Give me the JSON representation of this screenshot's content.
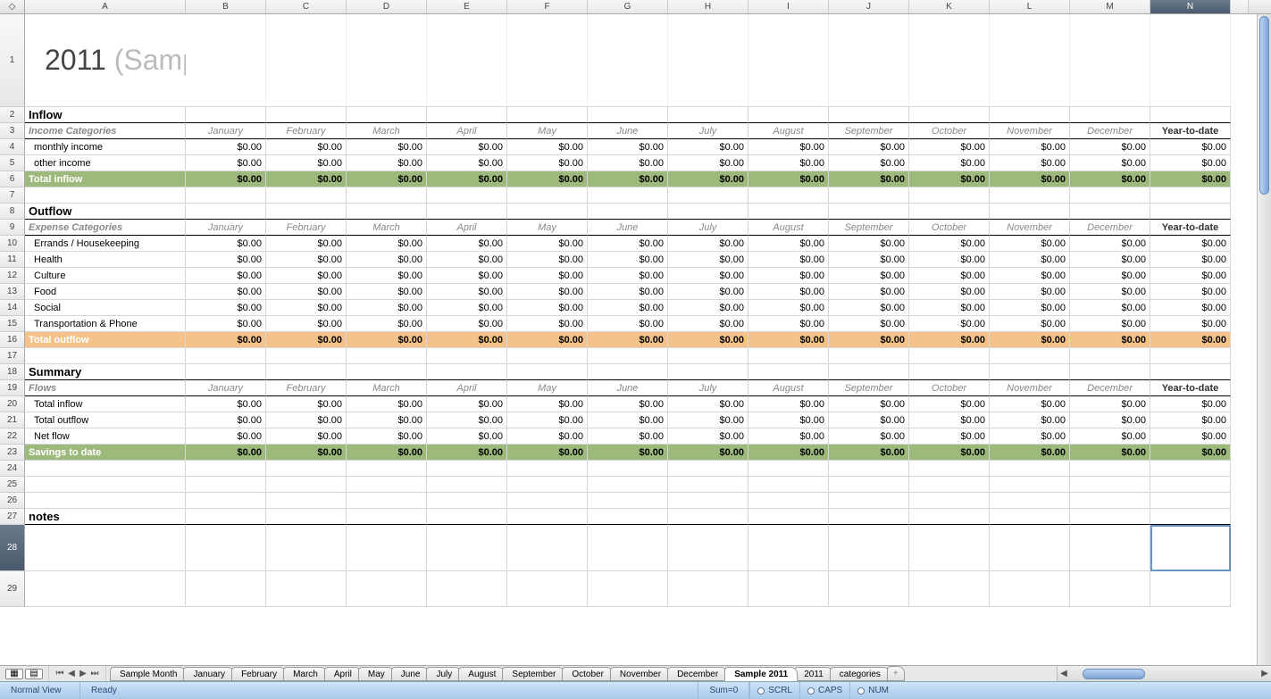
{
  "title": {
    "year": "2011",
    "sample": "(Sample)"
  },
  "columns": [
    "A",
    "B",
    "C",
    "D",
    "E",
    "F",
    "G",
    "H",
    "I",
    "J",
    "K",
    "L",
    "M",
    "N"
  ],
  "selected_column": "N",
  "colWidths": {
    "A": 180,
    "default": 90
  },
  "rows": {
    "count": 29,
    "selected": 28,
    "titleRow": 1,
    "heights": {
      "1": 104,
      "28": 52,
      "29": 40,
      "default": 18
    }
  },
  "months": [
    "January",
    "February",
    "March",
    "April",
    "May",
    "June",
    "July",
    "August",
    "September",
    "October",
    "November",
    "December"
  ],
  "ytd_label": "Year-to-date",
  "inflow": {
    "section": "Inflow",
    "header": "Income Categories",
    "items": [
      "monthly income",
      "other income"
    ],
    "total_label": "Total inflow"
  },
  "outflow": {
    "section": "Outflow",
    "header": "Expense Categories",
    "items": [
      "Errands / Housekeeping",
      "Health",
      "Culture",
      "Food",
      "Social",
      "Transportation & Phone"
    ],
    "total_label": "Total outflow"
  },
  "summary": {
    "section": "Summary",
    "header": "Flows",
    "items": [
      "Total inflow",
      "Total outflow",
      "Net flow"
    ],
    "total_label": "Savings to date"
  },
  "notes_label": "notes",
  "zero": "$0.00",
  "sheet_tabs": [
    "Sample Month",
    "January",
    "February",
    "March",
    "April",
    "May",
    "June",
    "July",
    "August",
    "September",
    "October",
    "November",
    "December",
    "Sample 2011",
    "2011",
    "categories"
  ],
  "active_tab": "Sample 2011",
  "status": {
    "view": "Normal View",
    "ready": "Ready",
    "sum": "Sum=0",
    "indicators": [
      "SCRL",
      "CAPS",
      "NUM"
    ]
  }
}
